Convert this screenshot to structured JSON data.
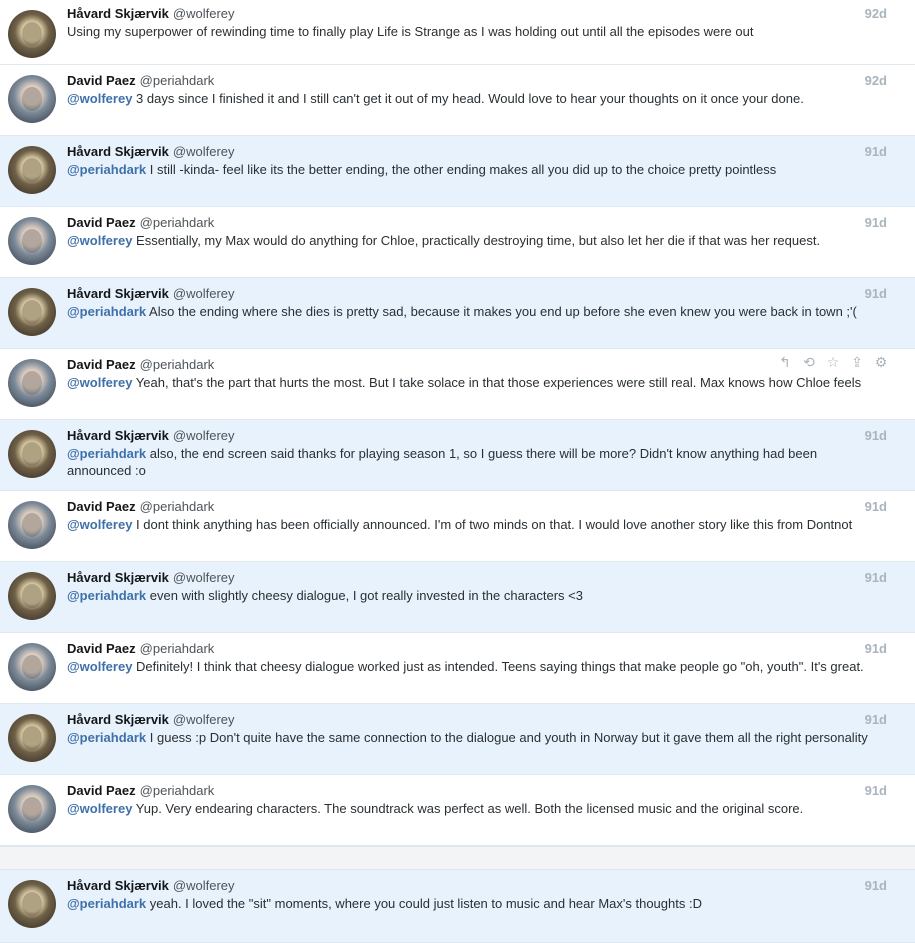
{
  "colors": {
    "highlight_row": "#e8f2fd",
    "mention": "#3f70a8",
    "timestamp": "#a9b4bd"
  },
  "hover_actions": {
    "reply_icon": "↰",
    "retweet_icon": "⟲",
    "favorite_icon": "☆",
    "share_icon": "⇪",
    "settings_icon": "⚙"
  },
  "tweets": [
    {
      "name": "Håvard Skjærvik",
      "handle": "@wolferey",
      "time": "92d",
      "mention": "",
      "text": "Using my superpower of rewinding time to finally play Life is Strange as I was holding out until all the episodes were out"
    },
    {
      "name": "David Paez",
      "handle": "@periahdark",
      "time": "92d",
      "mention": "@wolferey",
      "text": " 3 days since I finished it and I still can't get it out of my head. Would love to hear your thoughts on it once your done."
    },
    {
      "name": "Håvard Skjærvik",
      "handle": "@wolferey",
      "time": "91d",
      "mention": "@periahdark",
      "text": " I still -kinda- feel like its the better ending, the other ending makes all you did up to the choice pretty pointless"
    },
    {
      "name": "David Paez",
      "handle": "@periahdark",
      "time": "91d",
      "mention": "@wolferey",
      "text": " Essentially, my Max would do anything for Chloe, practically destroying time, but also let her die if that was her request."
    },
    {
      "name": "Håvard Skjærvik",
      "handle": "@wolferey",
      "time": "91d",
      "mention": "@periahdark",
      "text": " Also the ending where she dies is pretty sad, because it makes you end up before she even knew you were back in town ;'("
    },
    {
      "name": "David Paez",
      "handle": "@periahdark",
      "time": "",
      "mention": "@wolferey",
      "text": " Yeah, that's the part that hurts the most. But I take solace in that those experiences were still real. Max knows how Chloe feels"
    },
    {
      "name": "Håvard Skjærvik",
      "handle": "@wolferey",
      "time": "91d",
      "mention": "@periahdark",
      "text": " also, the end screen said thanks for playing season 1, so I guess there will be more? Didn't know anything had been announced :o"
    },
    {
      "name": "David Paez",
      "handle": "@periahdark",
      "time": "91d",
      "mention": "@wolferey",
      "text": " I dont think anything has been officially announced. I'm of two minds on that. I would love another story like this from Dontnot"
    },
    {
      "name": "Håvard Skjærvik",
      "handle": "@wolferey",
      "time": "91d",
      "mention": "@periahdark",
      "text": " even with slightly cheesy dialogue, I got really invested in the characters <3"
    },
    {
      "name": "David Paez",
      "handle": "@periahdark",
      "time": "91d",
      "mention": "@wolferey",
      "text": " Definitely! I think that cheesy dialogue worked just as intended. Teens saying things that make people go \"oh, youth\". It's great."
    },
    {
      "name": "Håvard Skjærvik",
      "handle": "@wolferey",
      "time": "91d",
      "mention": "@periahdark",
      "text": " I guess :p Don't quite have the same connection to the dialogue and youth in Norway but it gave them all the right personality"
    },
    {
      "name": "David Paez",
      "handle": "@periahdark",
      "time": "91d",
      "mention": "@wolferey",
      "text": " Yup. Very endearing characters. The soundtrack was perfect as well. Both the licensed music and the original score."
    },
    {
      "name": "Håvard Skjærvik",
      "handle": "@wolferey",
      "time": "91d",
      "mention": "@periahdark",
      "text": " yeah. I loved the \"sit\" moments, where you could just listen to music and hear Max's thoughts :D"
    }
  ]
}
